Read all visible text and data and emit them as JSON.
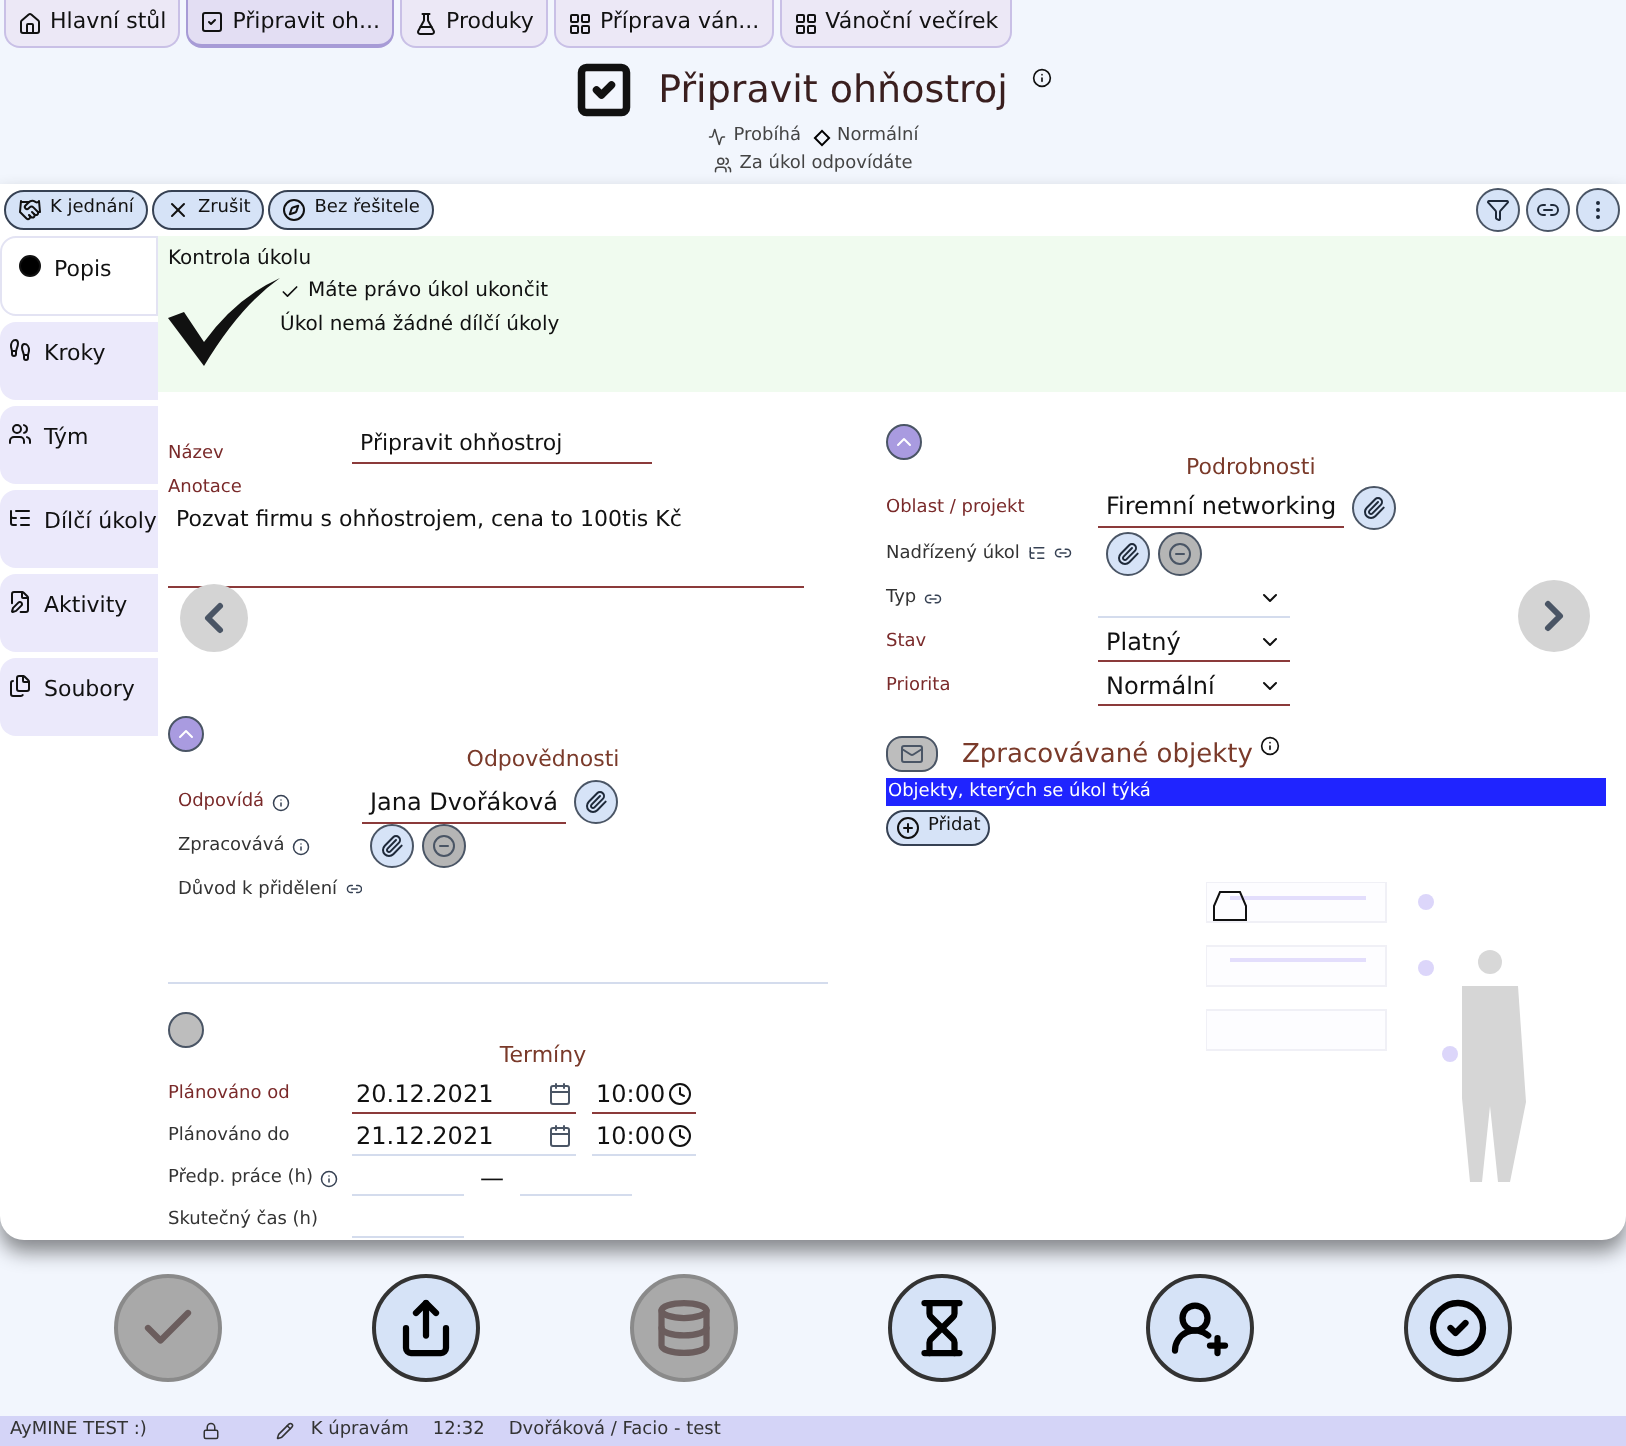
{
  "tabs": [
    {
      "label": "Hlavní stůl",
      "selected": false
    },
    {
      "label": "Připravit oh...",
      "selected": true
    },
    {
      "label": "Produky",
      "selected": false
    },
    {
      "label": "Příprava ván...",
      "selected": false
    },
    {
      "label": "Vánoční večírek",
      "selected": false
    }
  ],
  "header": {
    "title": "Připravit ohňostroj",
    "state": "Probíhá",
    "priority": "Normální",
    "role": "Za úkol odpovídáte"
  },
  "toolbar": [
    {
      "label": "K jednání"
    },
    {
      "label": "Zrušit"
    },
    {
      "label": "Bez řešitele"
    }
  ],
  "sidebar": [
    {
      "label": "Popis",
      "selected": true
    },
    {
      "label": "Kroky",
      "selected": false
    },
    {
      "label": "Tým",
      "selected": false
    },
    {
      "label": "Dílčí úkoly",
      "selected": false
    },
    {
      "label": "Aktivity",
      "selected": false
    },
    {
      "label": "Soubory",
      "selected": false
    }
  ],
  "check": {
    "title": "Kontrola úkolu",
    "items": [
      {
        "text": "Máte právo úkol ukončit",
        "checked": true
      },
      {
        "text": "Úkol nemá žádné dílčí úkoly",
        "checked": false
      }
    ]
  },
  "main_fields": [
    {
      "kind": "text",
      "label": "Název",
      "value": "Připravit ohňostroj",
      "required": true
    },
    {
      "kind": "textarea",
      "label": "Anotace",
      "value": "Pozvat firmu s ohňostrojem, cena to 100tis Kč",
      "required": true
    }
  ],
  "responsibility": {
    "title": "Odpovědnosti",
    "expanded": true,
    "rows": [
      {
        "kind": "link",
        "label": "Odpovídá",
        "value": "Jana Dvořáková",
        "required": true
      },
      {
        "kind": "link-empty",
        "label": "Zpracovává",
        "required": false
      },
      {
        "kind": "text",
        "label": "Důvod k přidělení",
        "required": false
      }
    ]
  },
  "terms": {
    "title": "Termíny",
    "expanded": false,
    "rows": [
      {
        "kind": "datetime",
        "label": "Plánováno od",
        "date": "20.12.2021",
        "time": "10:00",
        "required": true
      },
      {
        "kind": "datetime",
        "label": "Plánováno do",
        "date": "21.12.2021",
        "time": "10:00",
        "required": false
      },
      {
        "kind": "range",
        "label": "Předp. práce (h)",
        "separator": "—",
        "required": false
      },
      {
        "kind": "number",
        "label": "Skutečný čas (h)",
        "required": false
      }
    ]
  },
  "details": {
    "title": "Podrobnosti",
    "expanded": true,
    "rows": [
      {
        "kind": "link",
        "label": "Oblast / projekt",
        "value": "Firemní networking",
        "required": true
      },
      {
        "kind": "link-empty",
        "label": "Nadřízený úkol",
        "required": false
      },
      {
        "kind": "select",
        "label": "Typ",
        "required": false
      },
      {
        "kind": "select",
        "label": "Stav",
        "value": "Platný",
        "required": true
      },
      {
        "kind": "select",
        "label": "Priorita",
        "value": "Normální",
        "required": true
      }
    ]
  },
  "objects": {
    "title": "Zpracovávané objekty",
    "mail_disabled": true,
    "banner": "Objekty, kterých se úkol týká",
    "add": "Přidat"
  },
  "actions": [
    {
      "disabled": true
    },
    {
      "disabled": false
    },
    {
      "disabled": true
    },
    {
      "disabled": false
    },
    {
      "disabled": false
    },
    {
      "disabled": false
    }
  ],
  "status_bar": {
    "app": "AyMINE TEST :)",
    "mode": "K úpravám",
    "time": "12:32",
    "user": "Dvořáková / Facio - test"
  }
}
